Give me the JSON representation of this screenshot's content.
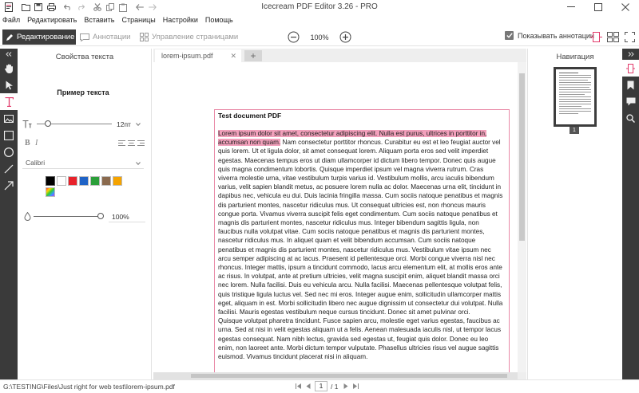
{
  "titlebar": {
    "title": "Icecream PDF Editor 3.26 - PRO"
  },
  "menu": [
    "Файл",
    "Редактировать",
    "Вставить",
    "Страницы",
    "Настройки",
    "Помощь"
  ],
  "toolbar": {
    "edit_label": "Редактирование",
    "annotations_label": "Аннотации",
    "pages_label": "Управление страницами",
    "zoom": "100%",
    "show_annotations_label": "Показывать аннотации",
    "show_annotations_checked": true
  },
  "text_props": {
    "title": "Свойства текста",
    "sample": "Пример текста",
    "size": "12пт",
    "font": "Calibri",
    "opacity": "100%",
    "colors": [
      "#000000",
      "#ffffff",
      "#e8222a",
      "#1f63c6",
      "#2b9f3a",
      "#8a6a4e",
      "#f5a300"
    ]
  },
  "document": {
    "tab_name": "lorem-ipsum.pdf",
    "title": "Test document PDF",
    "highlight": "Lorem ipsum dolor sit amet, consectetur adipiscing elit. Nulla est purus, ultrices in porttitor in, accumsan non quam.",
    "para1_rest": " Nam consectetur porttitor rhoncus. Curabitur eu est et leo feugiat auctor vel quis lorem. Ut et ligula dolor, sit amet consequat lorem. Aliquam porta eros sed velit imperdiet egestas. Maecenas tempus eros ut diam ullamcorper id dictum libero tempor. Donec quis augue quis magna condimentum lobortis. Quisque imperdiet ipsum vel magna viverra rutrum. Cras viverra molestie urna, vitae vestibulum turpis varius id. Vestibulum mollis, arcu iaculis bibendum varius, velit sapien blandit metus, ac posuere lorem nulla ac dolor. Maecenas urna elit, tincidunt in dapibus nec, vehicula eu dui. Duis lacinia fringilla massa. Cum sociis natoque penatibus et magnis dis parturient montes, nascetur ridiculus mus. Ut consequat ultricies est, non rhoncus mauris congue porta. Vivamus viverra suscipit felis eget condimentum. Cum sociis natoque penatibus et magnis dis parturient montes, nascetur ridiculus mus. Integer bibendum sagittis ligula, non faucibus nulla volutpat vitae. Cum sociis natoque penatibus et magnis dis parturient montes, nascetur ridiculus mus. In aliquet quam et velit bibendum accumsan. Cum sociis natoque penatibus et magnis dis parturient montes, nascetur ridiculus mus. Vestibulum vitae ipsum nec arcu semper adipiscing at ac lacus. Praesent id pellentesque orci. Morbi congue viverra nisl nec rhoncus. Integer mattis, ipsum a tincidunt commodo, lacus arcu elementum elit, at mollis eros ante ac risus. In volutpat, ante at pretium ultricies, velit magna suscipit enim, aliquet blandit massa orci nec lorem. Nulla facilisi. Duis eu vehicula arcu. Nulla facilisi. Maecenas pellentesque volutpat felis, quis tristique ligula luctus vel. Sed nec mi eros. Integer augue enim, sollicitudin ullamcorper mattis eget, aliquam in est. Morbi sollicitudin libero nec augue dignissim ut consectetur dui volutpat. Nulla facilisi. Mauris egestas vestibulum neque cursus tincidunt. Donec sit amet pulvinar orci.",
    "para2": "Quisque volutpat pharetra tincidunt. Fusce sapien arcu, molestie eget varius egestas, faucibus ac urna. Sed at nisi in velit egestas aliquam ut a felis. Aenean malesuada iaculis nisl, ut tempor lacus egestas consequat. Nam nibh lectus, gravida sed egestas ut, feugiat quis dolor. Donec eu leo enim, non laoreet ante. Morbi dictum tempor vulputate. Phasellus ultricies risus vel augue sagittis euismod. Vivamus tincidunt placerat nisi in aliquam."
  },
  "navigation": {
    "title": "Навигация",
    "page_badge": "1"
  },
  "status": {
    "path": "G:\\TESTING\\Files\\Just right for web test\\lorem-ipsum.pdf",
    "page_current": "1",
    "page_total": "/ 1"
  }
}
